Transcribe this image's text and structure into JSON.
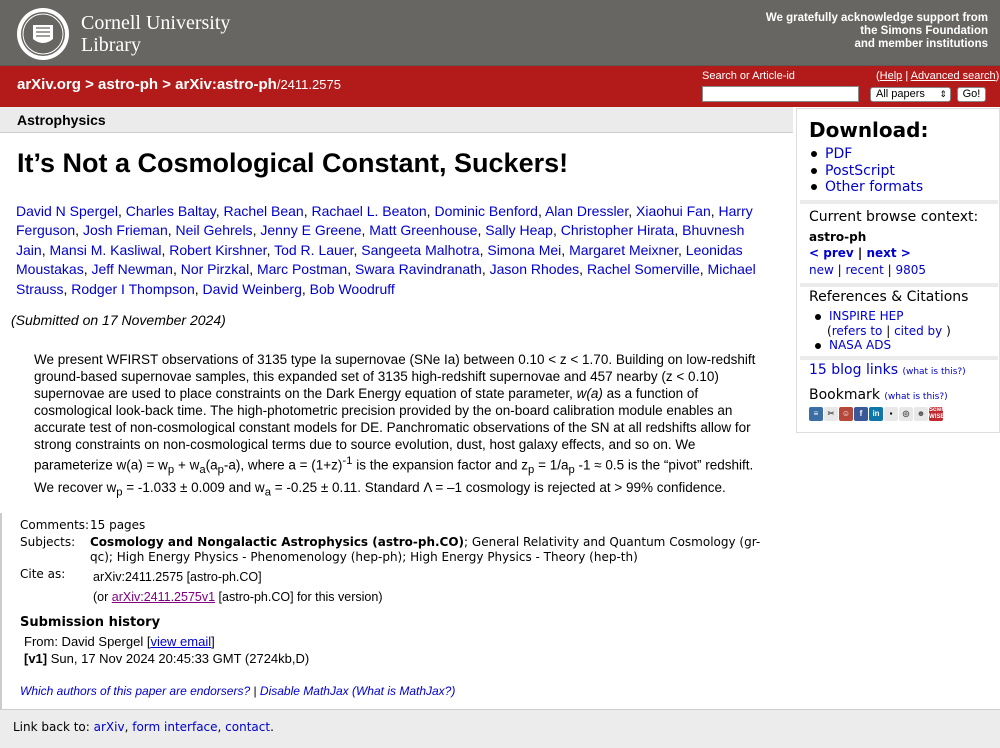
{
  "header": {
    "org_line1": "Cornell University",
    "org_line2": "Library",
    "ack_line1": "We gratefully acknowledge support from",
    "ack_line2": "the Simons Foundation",
    "ack_line3": "and member institutions"
  },
  "nav": {
    "crumb1": "arXiv.org",
    "sep": ">",
    "crumb2": "astro-ph",
    "crumb3": "arXiv:astro-ph",
    "crumb_id": "/2411.2575",
    "search_label": "Search or Article-id",
    "help_label": "Help",
    "advanced_label": "Advanced search",
    "search_value": "",
    "select_value": "All papers",
    "go_label": "Go!"
  },
  "subject_bar": "Astrophysics",
  "paper": {
    "title": "It’s Not a Cosmological Constant, Suckers!",
    "authors": [
      "David N Spergel",
      "Charles Baltay",
      "Rachel Bean",
      "Rachael L. Beaton",
      "Dominic Benford",
      "Alan Dressler",
      "Xiaohui Fan",
      "Harry Ferguson",
      "Josh Frieman",
      "Neil Gehrels",
      "Jenny E Greene",
      "Matt Greenhouse",
      "Sally Heap",
      "Christopher Hirata",
      "Bhuvnesh Jain",
      "Mansi M. Kasliwal",
      "Robert Kirshner",
      "Tod R. Lauer",
      "Sangeeta Malhotra",
      "Simona Mei",
      "Margaret Meixner",
      "Leonidas Moustakas",
      "Jeff Newman",
      "Nor Pirzkal",
      "Marc Postman",
      "Swara Ravindranath",
      "Jason Rhodes",
      "Rachel Somerville",
      "Michael Strauss",
      "Rodger I Thompson",
      "David Weinberg",
      "Bob Woodruff"
    ],
    "submitted": "(Submitted on 17 November 2024)",
    "abstract_p1": "We present WFIRST observations of 3135 type Ia supernovae (SNe Ia) between 0.10 < z < 1.70. Building on low-redshift ground-based supernovae samples, this expanded set of 3135 high-redshift supernovae and 457 nearby (z < 0.10) supernovae are used to place constraints on the Dark Energy equation of state parameter, ",
    "abstract_wa": "w(a)",
    "abstract_p2": " as a function of cosmological look-back time. The high-photometric precision provided by the on-board calibration module enables an accurate test of non-cosmological constant models for DE.  Panchromatic observations of the SN at all redshifts allow for strong constraints on non-cosmological terms due to source evolution, dust, host galaxy effects, and so on.  We parameterize w(a) = w",
    "abstract_p3": "p",
    "abstract_p4": " + w",
    "abstract_p5": "a",
    "abstract_p6": "(a",
    "abstract_p7": "p",
    "abstract_p8": "-a), where a = (1+z)",
    "abstract_p9": "-1",
    "abstract_p10": " is the expansion factor and z",
    "abstract_p11": "p",
    "abstract_p12": " = 1/a",
    "abstract_p13": "p",
    "abstract_p14": " -1 ≈ 0.5 is the “pivot” redshift. We recover w",
    "abstract_p15": "p",
    "abstract_p16": " = -1.033 ± 0.009 and w",
    "abstract_p17": "a",
    "abstract_p18": " = -0.25 ± 0.11.  Standard Λ = –1 cosmology is rejected at > 99% confidence."
  },
  "meta": {
    "comments_label": "Comments:",
    "comments_value": "15 pages",
    "subjects_label": "Subjects:",
    "subjects_primary": "Cosmology and Nongalactic Astrophysics (astro-ph.CO)",
    "subjects_rest": "; General Relativity and Quantum Cosmology (gr-qc); High Energy Physics - Phenomenology (hep-ph); High Energy Physics - Theory (hep-th)",
    "cite_label": "Cite as:",
    "cite_value": "arXiv:2411.2575 [astro-ph.CO]",
    "cite_or_pre": "(or ",
    "cite_or_link": "arXiv:2411.2575v1",
    "cite_or_post": " [astro-ph.CO] for this version)",
    "history_title": "Submission history",
    "from_pre": "From: David Spergel [",
    "from_link": "view email",
    "from_post": "]",
    "v1_label": "[v1]",
    "v1_value": " Sun, 17 Nov 2024 20:45:33 GMT (2724kb,D)",
    "endorsers_link": "Which authors of this paper are endorsers?",
    "sep": " | ",
    "mathjax_link": "Disable MathJax",
    "whatis_link": "(What is MathJax?)"
  },
  "footer": {
    "prefix": "Link back to: ",
    "link1": "arXiv",
    "link2": "form interface",
    "link3": "contact"
  },
  "sidebar": {
    "download_title": "Download:",
    "formats": [
      "PDF",
      "PostScript",
      "Other formats"
    ],
    "context_title": "Current browse context:",
    "context_value": "astro-ph",
    "prev": "< prev",
    "next": "next >",
    "new": "new",
    "recent": "recent",
    "yymm": "9805",
    "refs_title": "References & Citations",
    "inspire": "INSPIRE HEP",
    "refers_to": "refers to",
    "cited_by": "cited by",
    "nasa": "NASA ADS",
    "blog_links": "15 blog links",
    "whatisthis": "(what is this?)",
    "bookmark": "Bookmark",
    "bookmark_icons": [
      "bibsonomy-icon",
      "citeulike-icon",
      "delicious-icon",
      "facebook-icon",
      "linkedin-icon",
      "mendeley-icon",
      "digg-icon",
      "reddit-icon",
      "sciencewise-icon"
    ],
    "sciencewise_label": "Science WISE"
  }
}
